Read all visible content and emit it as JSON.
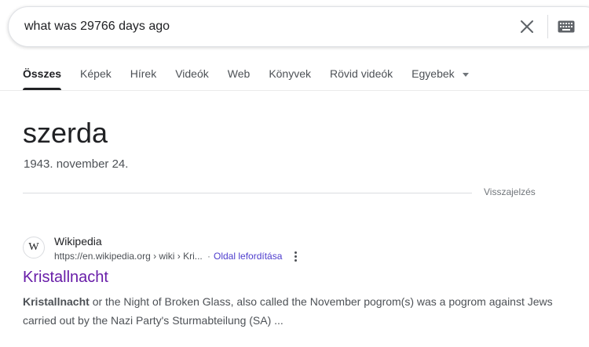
{
  "search": {
    "query": "what was 29766 days ago"
  },
  "tabs": [
    {
      "label": "Összes",
      "active": true
    },
    {
      "label": "Képek"
    },
    {
      "label": "Hírek"
    },
    {
      "label": "Videók"
    },
    {
      "label": "Web"
    },
    {
      "label": "Könyvek"
    },
    {
      "label": "Rövid videók"
    },
    {
      "label": "Egyebek"
    }
  ],
  "answer": {
    "day": "szerda",
    "date": "1943. november 24.",
    "feedback": "Visszajelzés"
  },
  "result": {
    "favicon_letter": "W",
    "site_name": "Wikipedia",
    "url": "https://en.wikipedia.org › wiki › Kri...",
    "translate_sep": "·",
    "translate_label": "Oldal lefordítása",
    "title": "Kristallnacht",
    "snippet_bold": "Kristallnacht",
    "snippet_rest": " or the Night of Broken Glass, also called the November pogrom(s) was a pogrom against Jews carried out by the Nazi Party's Sturmabteilung (SA) ..."
  },
  "colors": {
    "link_visited": "#681da8",
    "translate_link": "#4d3ccd",
    "active_tab": "#202124"
  },
  "icons": {
    "clear": "close-icon",
    "keyboard": "keyboard-icon",
    "more": "more-vert-icon",
    "caret": "caret-down-icon"
  }
}
